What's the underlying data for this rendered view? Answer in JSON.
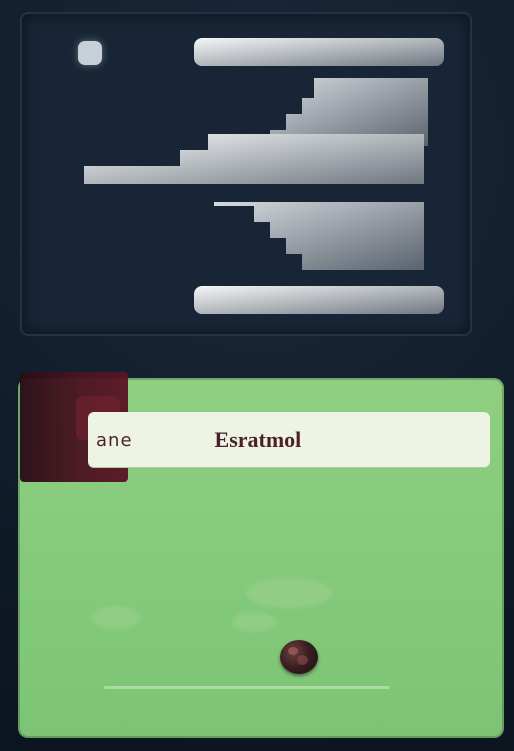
{
  "panel": {
    "left_label": "ane",
    "title": "Esratmol"
  },
  "icons": {
    "top_dot": "dot-icon",
    "top_graphic": "layers-icon",
    "ball": "ball-icon"
  },
  "colors": {
    "background": "#101c29",
    "panel": "#172536",
    "field": "#8fcf82",
    "header": "#eef4e4",
    "title": "#4c1f2a",
    "accent": "#5b1526",
    "icon": "#c7d0d8"
  }
}
